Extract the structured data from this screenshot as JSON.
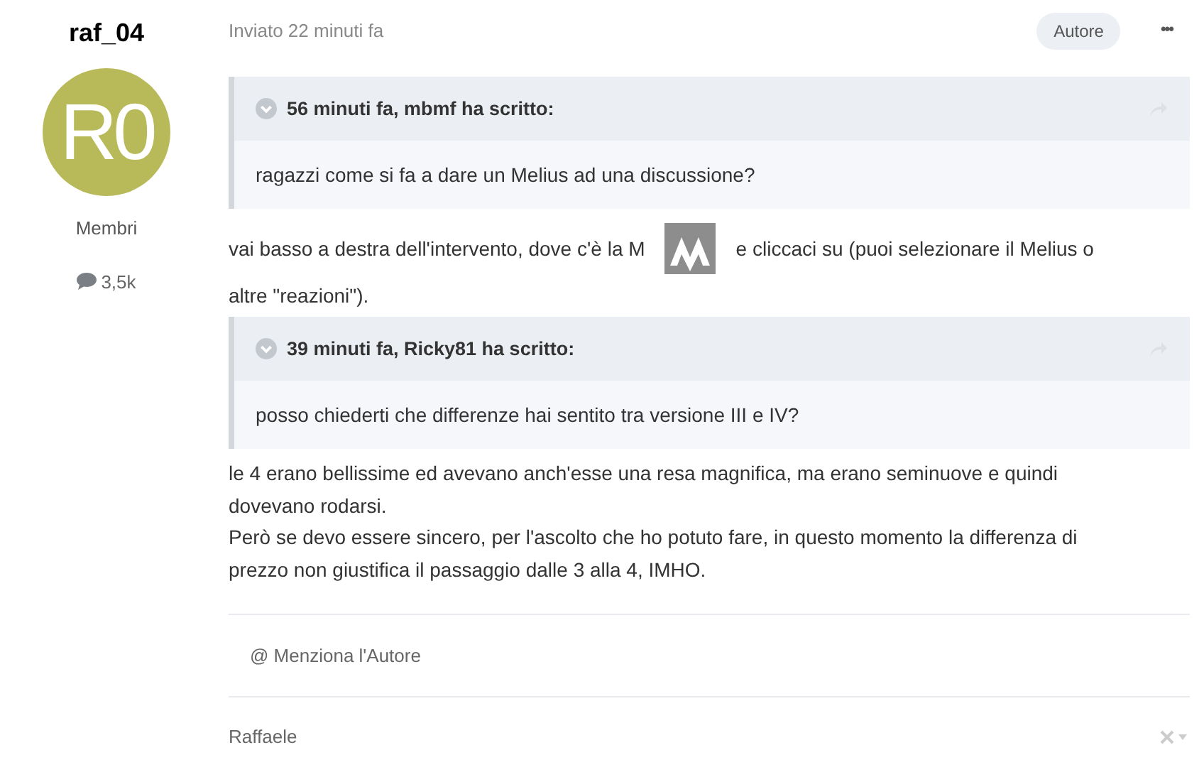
{
  "author": {
    "name": "raf_04",
    "avatar_initials": "R0",
    "group": "Membri",
    "posts": "3,5k"
  },
  "post": {
    "meta": "Inviato 22 minuti fa",
    "badge": "Autore",
    "menu": "•••",
    "content": [
      {
        "kind": "quote",
        "header": "56 minuti fa, mbmf ha scritto:",
        "body": "ragazzi come si fa a dare un Melius ad una discussione?"
      },
      {
        "kind": "image_text",
        "before": "vai basso a destra dell'intervento, dove c'è la M",
        "after": "e cliccaci su (puoi selezionare il Melius o",
        "next_line": "altre \"reazioni\")."
      },
      {
        "kind": "quote",
        "header": "39 minuti fa, Ricky81 ha scritto:",
        "body": "posso chiederti che differenze hai sentito tra versione III e IV?"
      },
      {
        "kind": "paragraph",
        "lines": [
          "le 4 erano bellissime ed avevano anch'esse una resa magnifica, ma erano seminuove e quindi",
          "dovevano rodarsi.",
          "Però se devo essere sincero, per l'ascolto che ho potuto fare, in questo momento la differenza di",
          "prezzo non giustifica il passaggio dalle 3 alla 4, IMHO."
        ]
      }
    ],
    "mention": "@ Menziona l'Autore",
    "signature": "Raffaele"
  }
}
